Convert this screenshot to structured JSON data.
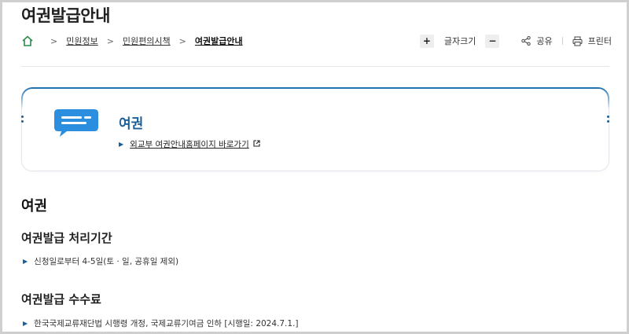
{
  "page": {
    "title": "여권발급안내"
  },
  "breadcrumb": {
    "items": [
      {
        "label": "민원정보"
      },
      {
        "label": "민원편의시책"
      },
      {
        "label": "여권발급안내"
      }
    ]
  },
  "tools": {
    "font_size_label": "글자크기",
    "increase_label": "+",
    "decrease_label": "−",
    "share_label": "공유",
    "print_label": "프린터"
  },
  "card": {
    "title": "여권",
    "link_label": "외교부 여권안내홈페이지 바로가기"
  },
  "content": {
    "heading": "여권",
    "sections": [
      {
        "title": "여권발급 처리기간",
        "bullet": "신청일로부터 4-5일(토 · 일, 공휴일 제외)"
      },
      {
        "title": "여권발급 수수료",
        "bullet": "한국국제교류재단법 시행령 개정, 국제교류기여금 인하 [시행일: 2024.7.1.]"
      }
    ]
  },
  "colors": {
    "accent": "#1b5f9a",
    "icon_blue": "#2b8ede",
    "divider": "#e6e6e6"
  }
}
